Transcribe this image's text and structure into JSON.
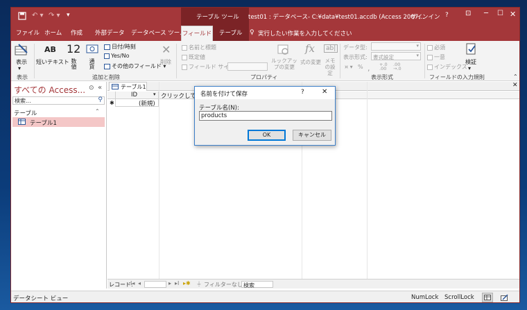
{
  "window": {
    "title": "test01 : データベース- C:¥data¥test01.accdb (Access 2007…",
    "context_tab_group": "テーブル ツール",
    "signin": "サインイン",
    "help": "?"
  },
  "tabs": [
    {
      "label": "ファイル"
    },
    {
      "label": "ホーム"
    },
    {
      "label": "作成"
    },
    {
      "label": "外部データ"
    },
    {
      "label": "データベース ツール"
    },
    {
      "label": "フィールド"
    },
    {
      "label": "テーブル"
    }
  ],
  "tellme": "実行したい作業を入力してください",
  "ribbon": {
    "view_label": "表示",
    "short_text": "短いテキスト",
    "number_label": "数値",
    "number_big": "12",
    "currency_label": "通貨",
    "datetime": "日付/時刻",
    "yesno": "Yes/No",
    "more_fields": "その他のフィールド",
    "delete": "削除",
    "group_view": "表示",
    "group_add_delete": "追加と削除",
    "name_caption": "名前と標題",
    "default_value": "既定値",
    "field_size": "フィールド サイズ",
    "lookup_change": "ルックアップの変更",
    "formula_change": "式の変更",
    "memo_settings": "メモの設定",
    "group_properties": "プロパティ",
    "data_type": "データ型:",
    "format_label": "表示形式:",
    "format_value": "書式設定",
    "group_format": "表示形式",
    "required": "必須",
    "unique": "一意",
    "indexed": "インデックス",
    "validation": "検証",
    "group_validation": "フィールドの入力規則"
  },
  "nav_pane": {
    "title": "すべての Access...",
    "search_placeholder": "検索...",
    "section": "テーブル",
    "items": [
      {
        "label": "テーブル1"
      }
    ]
  },
  "document": {
    "tab_label": "テーブル1",
    "col_id": "ID",
    "col_add": "クリックして",
    "new_row": "(新規)",
    "record_label": "レコード:",
    "filter_label": "フィルターなし",
    "search_label": "検索"
  },
  "dialog": {
    "title": "名前を付けて保存",
    "help": "?",
    "field_label": "テーブル名(N):",
    "field_value": "products",
    "ok": "OK",
    "cancel": "キャンセル"
  },
  "status": {
    "left": "データシート ビュー",
    "numlock": "NumLock",
    "scrolllock": "ScrollLock"
  },
  "colors": {
    "access_red": "#a4373a",
    "selected_item": "#f4c7c7",
    "dialog_border": "#3c7fc9"
  }
}
